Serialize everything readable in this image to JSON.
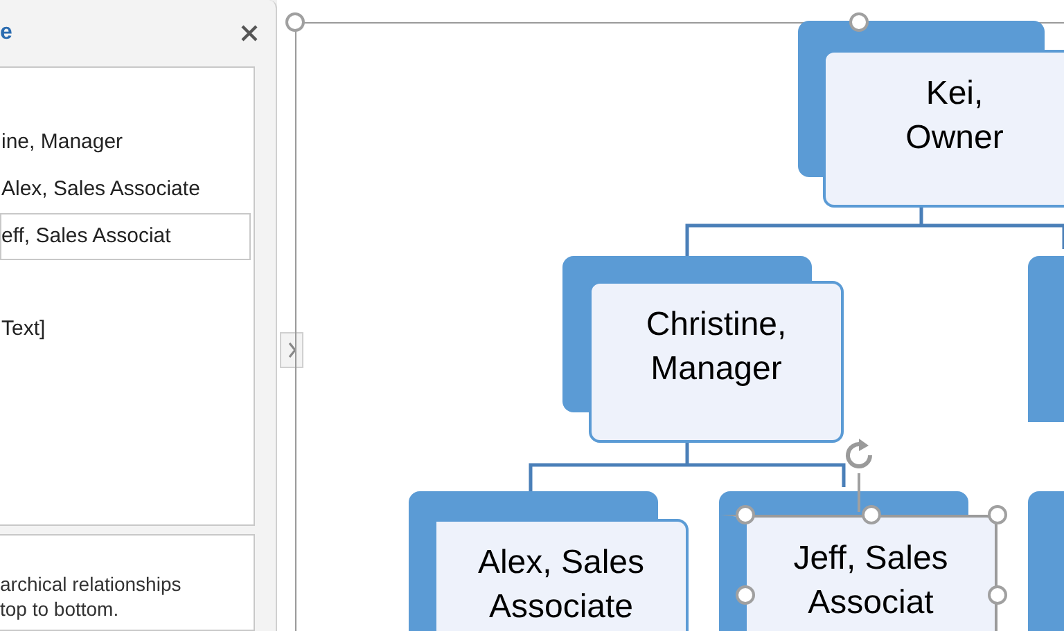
{
  "text_pane": {
    "title": "e",
    "items": [
      {
        "text": "ine, Manager",
        "selected": false,
        "children": [
          {
            "text": "Alex, Sales Associate",
            "selected": false
          },
          {
            "text": "eff, Sales Associat",
            "selected": true
          }
        ]
      },
      {
        "text": "Text]",
        "selected": false
      }
    ],
    "description_lines": [
      "archical relationships",
      "top to bottom."
    ]
  },
  "diagram": {
    "nodes": [
      {
        "text": "Kei, Owner",
        "selected": false
      },
      {
        "text": "Christine, Manager",
        "selected": false
      },
      {
        "text": "Alex, Sales Associate",
        "selected": false
      },
      {
        "text": "Jeff, Sales Associat",
        "selected": true
      }
    ]
  }
}
